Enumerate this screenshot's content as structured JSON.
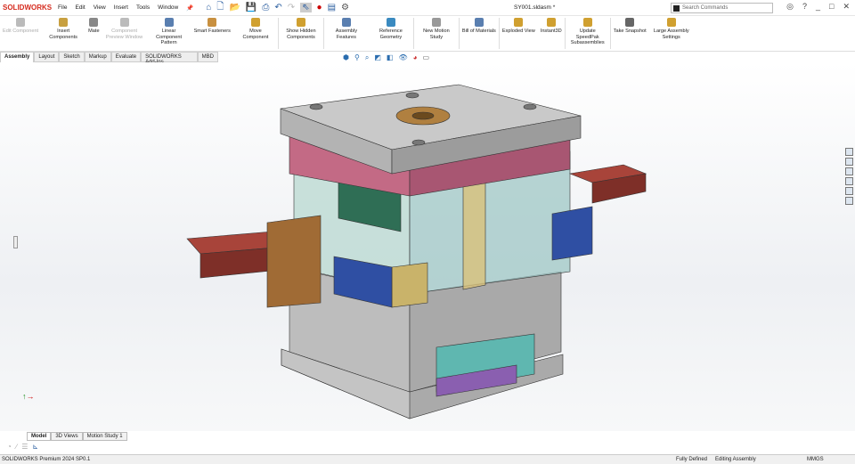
{
  "app": {
    "logo": "SOLIDWORKS",
    "doc_title": "SY001.sldasm *"
  },
  "menu": [
    "File",
    "Edit",
    "View",
    "Insert",
    "Tools",
    "Window"
  ],
  "search": {
    "placeholder": "Search Commands"
  },
  "ribbon": [
    {
      "label": "Edit Component",
      "disabled": true,
      "color": "#bbbbbb"
    },
    {
      "label": "Insert Components",
      "color": "#c8a040"
    },
    {
      "label": "Mate",
      "color": "#888888"
    },
    {
      "label": "Component Preview Window",
      "disabled": true,
      "color": "#bbbbbb"
    },
    {
      "label": "Linear Component Pattern",
      "color": "#5a7fb0"
    },
    {
      "label": "Smart Fasteners",
      "color": "#c89040"
    },
    {
      "label": "Move Component",
      "color": "#d0a030"
    },
    {
      "label": "Show Hidden Components",
      "color": "#d0a030"
    },
    {
      "label": "Assembly Features",
      "color": "#5a7fb0"
    },
    {
      "label": "Reference Geometry",
      "color": "#3a8ac0"
    },
    {
      "label": "New Motion Study",
      "color": "#999999"
    },
    {
      "label": "Bill of Materials",
      "color": "#5a7fb0"
    },
    {
      "label": "Exploded View",
      "color": "#d0a030"
    },
    {
      "label": "Instant3D",
      "color": "#d0a030"
    },
    {
      "label": "Update SpeedPak Subassemblies",
      "color": "#d0a030"
    },
    {
      "label": "Take Snapshot",
      "color": "#666666"
    },
    {
      "label": "Large Assembly Settings",
      "color": "#d0a030"
    }
  ],
  "tabs": [
    "Assembly",
    "Layout",
    "Sketch",
    "Markup",
    "Evaluate",
    "SOLIDWORKS Add-Ins",
    "MBD"
  ],
  "bottom_tabs": [
    "Model",
    "3D Views",
    "Motion Study 1"
  ],
  "status": {
    "product": "SOLIDWORKS Premium 2024 SP0.1",
    "state": "Fully Defined",
    "mode": "Editing Assembly",
    "units": "MMGS"
  },
  "window_buttons": [
    "_",
    "□",
    "✕"
  ]
}
